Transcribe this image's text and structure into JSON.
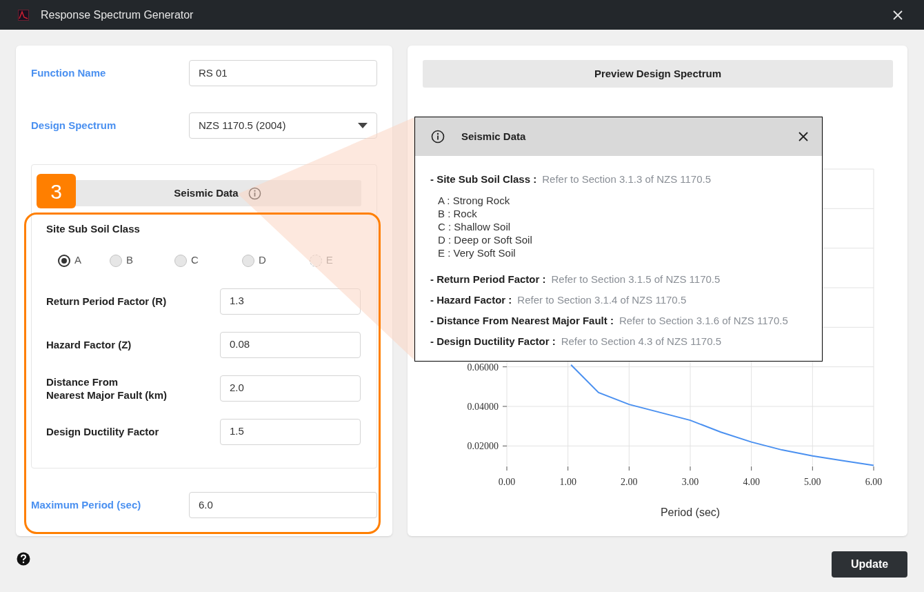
{
  "window": {
    "title": "Response Spectrum Generator"
  },
  "function_name": {
    "label": "Function Name",
    "value": "RS 01"
  },
  "design_spectrum": {
    "label": "Design Spectrum",
    "value": "NZS 1170.5 (2004)"
  },
  "seismic_data": {
    "title": "Seismic Data",
    "soil_class": {
      "label": "Site Sub Soil Class",
      "options": [
        {
          "label": "A",
          "selected": true,
          "disabled": false
        },
        {
          "label": "B",
          "selected": false,
          "disabled": false
        },
        {
          "label": "C",
          "selected": false,
          "disabled": false
        },
        {
          "label": "D",
          "selected": false,
          "disabled": false
        },
        {
          "label": "E",
          "selected": false,
          "disabled": true
        }
      ]
    },
    "fields": [
      {
        "label": "Return Period Factor (R)",
        "value": "1.3"
      },
      {
        "label": "Hazard Factor (Z)",
        "value": "0.08"
      },
      {
        "label": "Distance From\nNearest Major Fault (km)",
        "value": "2.0"
      },
      {
        "label": "Design Ductility Factor",
        "value": "1.5"
      }
    ]
  },
  "maximum_period": {
    "label": "Maximum Period (sec)",
    "value": "6.0"
  },
  "callout": {
    "number": "3"
  },
  "preview": {
    "title": "Preview Design Spectrum",
    "chart_data": {
      "type": "line",
      "xlabel": "Period (sec)",
      "x": [
        1.05,
        1.5,
        2.0,
        2.5,
        3.0,
        3.5,
        4.0,
        4.5,
        5.0,
        5.5,
        6.0
      ],
      "grid": true,
      "series": [
        {
          "color": "#4a90f0",
          "values": [
            0.061,
            0.047,
            0.041,
            0.037,
            0.033,
            0.027,
            0.022,
            0.018,
            0.015,
            0.0125,
            0.0102
          ]
        }
      ],
      "xlim": [
        0,
        6
      ],
      "ylim": [
        0.01,
        0.16
      ],
      "xticks": [
        {
          "value": 0,
          "label": "0.00"
        },
        {
          "value": 1,
          "label": "1.00"
        },
        {
          "value": 2,
          "label": "2.00"
        },
        {
          "value": 3,
          "label": "3.00"
        },
        {
          "value": 4,
          "label": "4.00"
        },
        {
          "value": 5,
          "label": "5.00"
        },
        {
          "value": 6,
          "label": "6.00"
        }
      ],
      "yticks": [
        {
          "value": 0.02,
          "label": "0.02000"
        },
        {
          "value": 0.04,
          "label": "0.04000"
        },
        {
          "value": 0.06,
          "label": "0.06000"
        }
      ]
    }
  },
  "info_popup": {
    "title": "Seismic Data",
    "items": [
      {
        "label": "- Site Sub Soil Class :",
        "reference": "Refer to Section 3.1.3 of NZS 1170.5",
        "details": [
          "A : Strong Rock",
          "B : Rock",
          "C : Shallow Soil",
          "D : Deep or Soft Soil",
          "E : Very Soft Soil"
        ]
      },
      {
        "label": "- Return Period Factor :",
        "reference": "Refer to Section 3.1.5 of NZS 1170.5"
      },
      {
        "label": "- Hazard Factor :",
        "reference": "Refer to Section 3.1.4 of NZS 1170.5"
      },
      {
        "label": "- Distance From Nearest Major Fault :",
        "reference": "Refer to Section 3.1.6 of NZS 1170.5"
      },
      {
        "label": "- Design Ductility Factor :",
        "reference": "Refer to Section 4.3 of NZS 1170.5"
      }
    ]
  },
  "buttons": {
    "update": "Update"
  }
}
